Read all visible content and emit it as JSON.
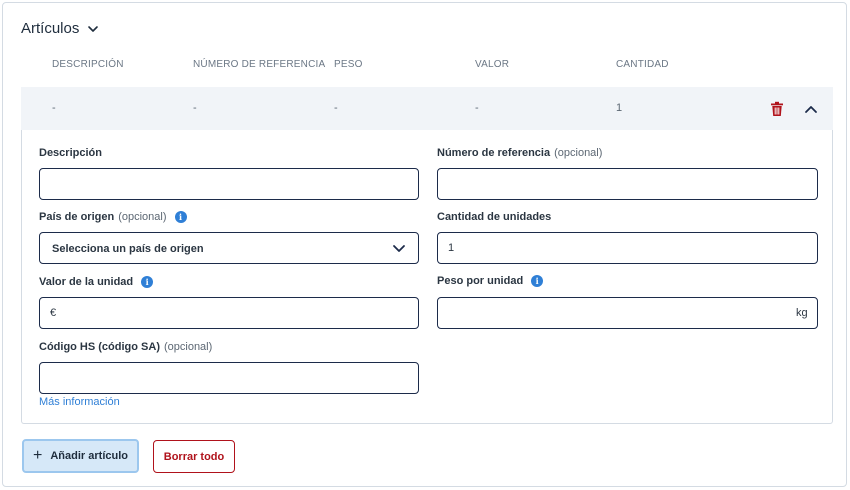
{
  "section": {
    "title": "Artículos"
  },
  "table": {
    "headers": [
      "DESCRIPCIÓN",
      "NÚMERO DE REFERENCIA",
      "PESO",
      "VALOR",
      "CANTIDAD"
    ],
    "row": [
      "-",
      "-",
      "-",
      "-",
      "1"
    ]
  },
  "form": {
    "description": {
      "label": "Descripción",
      "value": ""
    },
    "reference": {
      "label": "Número de referencia",
      "optional": "(opcional)",
      "value": ""
    },
    "origin": {
      "label": "País de origen",
      "optional": "(opcional)",
      "placeholder": "Selecciona un país de origen"
    },
    "quantity": {
      "label": "Cantidad de unidades",
      "value": "1"
    },
    "unit_value": {
      "label": "Valor de la unidad",
      "prefix": "€",
      "value": ""
    },
    "unit_weight": {
      "label": "Peso por unidad",
      "suffix": "kg",
      "value": ""
    },
    "hs_code": {
      "label": "Código HS (código SA)",
      "optional": "(opcional)",
      "value": ""
    },
    "more_info": "Más información",
    "info_glyph": "i"
  },
  "buttons": {
    "add": "Añadir artículo",
    "add_icon": "+",
    "clear": "Borrar todo"
  },
  "colors": {
    "accent": "#2f7fd6",
    "danger": "#b0121b",
    "border": "#1c2b4a",
    "row_bg": "#f1f4f8"
  }
}
